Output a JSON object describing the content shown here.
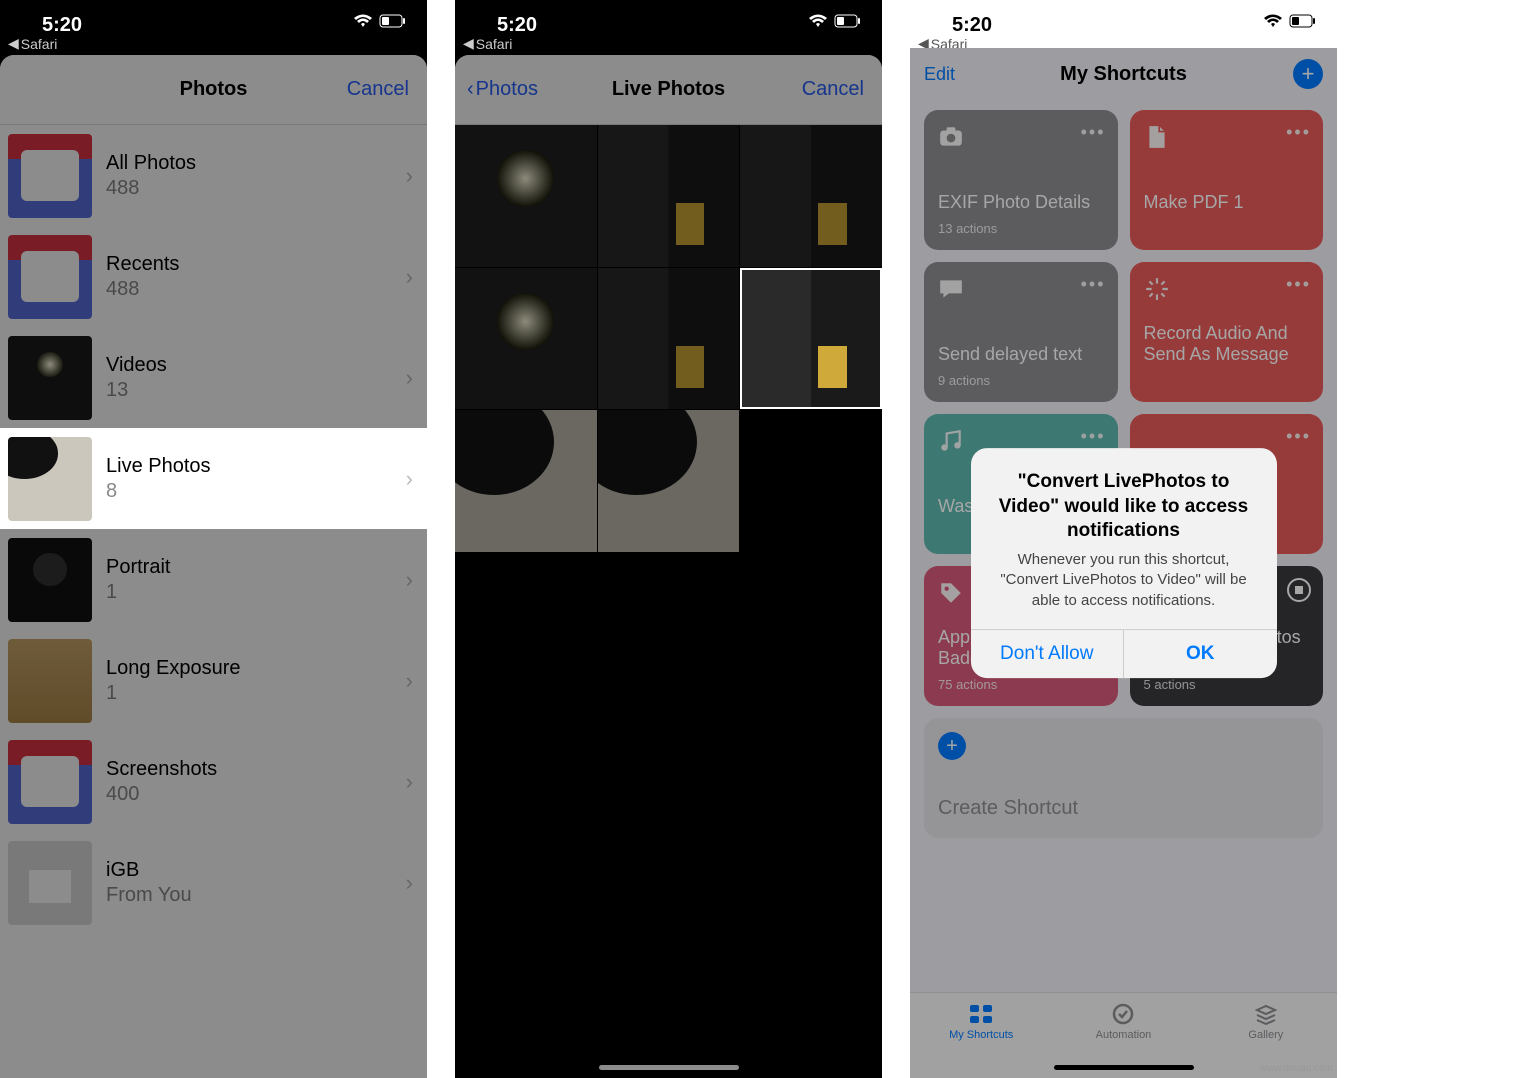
{
  "status": {
    "time": "5:20",
    "backApp": "Safari"
  },
  "screen1": {
    "title": "Photos",
    "cancel": "Cancel",
    "albums": [
      {
        "name": "All Photos",
        "count": "488"
      },
      {
        "name": "Recents",
        "count": "488"
      },
      {
        "name": "Videos",
        "count": "13"
      },
      {
        "name": "Live Photos",
        "count": "8"
      },
      {
        "name": "Portrait",
        "count": "1"
      },
      {
        "name": "Long Exposure",
        "count": "1"
      },
      {
        "name": "Screenshots",
        "count": "400"
      },
      {
        "name": "iGB",
        "subtitle": "From You"
      }
    ]
  },
  "screen2": {
    "back": "Photos",
    "title": "Live Photos",
    "cancel": "Cancel"
  },
  "screen3": {
    "edit": "Edit",
    "title": "My Shortcuts",
    "cards": [
      {
        "title": "EXIF Photo Details",
        "sub": "13 actions"
      },
      {
        "title": "Make PDF 1",
        "sub": ""
      },
      {
        "title": "Send delayed text",
        "sub": "9 actions"
      },
      {
        "title": "Record Audio And Send As Message",
        "sub": ""
      },
      {
        "title": "Wash Your Hands",
        "sub": ""
      },
      {
        "title": "",
        "sub": ""
      },
      {
        "title": "Apple Store Memoji Badge",
        "sub": "75 actions"
      },
      {
        "title": "Convert LivePhotos to Video",
        "sub": "5 actions"
      }
    ],
    "create": "Create Shortcut",
    "tabs": {
      "shortcuts": "My Shortcuts",
      "automation": "Automation",
      "gallery": "Gallery"
    },
    "alert": {
      "title": "\"Convert LivePhotos to Video\" would like to access notifications",
      "message": "Whenever you run this shortcut, \"Convert LivePhotos to Video\" will be able to access notifications.",
      "deny": "Don't Allow",
      "ok": "OK"
    }
  },
  "watermark": "www.deuaq.com"
}
